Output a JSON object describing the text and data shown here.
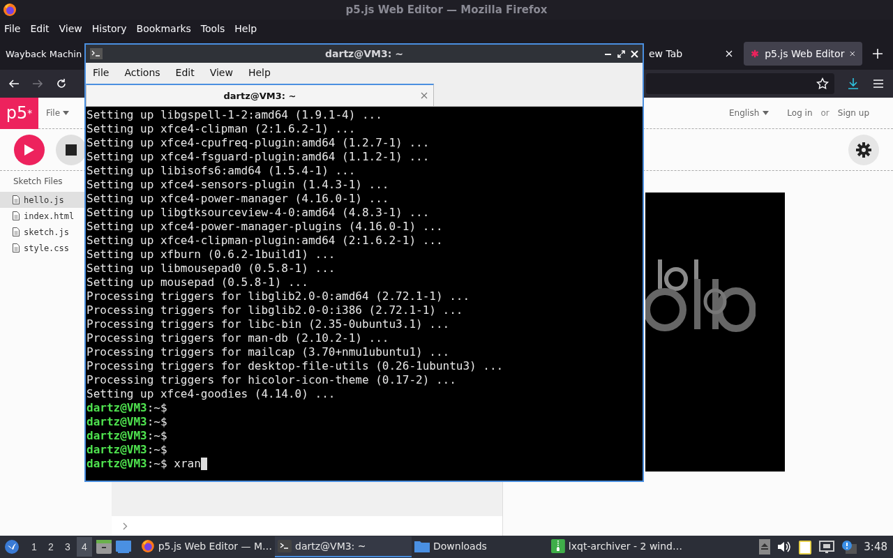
{
  "firefox": {
    "title": "p5.js Web Editor — Mozilla Firefox",
    "menu": [
      "File",
      "Edit",
      "View",
      "History",
      "Bookmarks",
      "Tools",
      "Help"
    ],
    "tabs": [
      {
        "label": "Wayback Machin",
        "selected": false,
        "kind": "cut"
      },
      {
        "label": "ew Tab",
        "selected": false,
        "kind": "plain"
      },
      {
        "label": "p5.js Web Editor",
        "selected": true,
        "kind": "p5"
      }
    ],
    "forward_disabled": true
  },
  "editor": {
    "logo": "p5$^{*}$",
    "file_menu": "File",
    "language": "English",
    "login": "Log in",
    "or": "or",
    "signup": "Sign up",
    "files_title": "Sketch Files",
    "files": [
      {
        "name": "hello.js",
        "selected": true
      },
      {
        "name": "index.html",
        "selected": false
      },
      {
        "name": "sketch.js",
        "selected": false
      },
      {
        "name": "style.css",
        "selected": false
      }
    ]
  },
  "terminal": {
    "title": "dartz@VM3: ~",
    "menu": [
      "File",
      "Actions",
      "Edit",
      "View",
      "Help"
    ],
    "tab": "dartz@VM3: ~",
    "lines": [
      {
        "kind": "output",
        "text": "Setting up libgspell-1-2:amd64 (1.9.1-4) ..."
      },
      {
        "kind": "output",
        "text": "Setting up xfce4-clipman (2:1.6.2-1) ..."
      },
      {
        "kind": "output",
        "text": "Setting up xfce4-cpufreq-plugin:amd64 (1.2.7-1) ..."
      },
      {
        "kind": "output",
        "text": "Setting up xfce4-fsguard-plugin:amd64 (1.1.2-1) ..."
      },
      {
        "kind": "output",
        "text": "Setting up libisofs6:amd64 (1.5.4-1) ..."
      },
      {
        "kind": "output",
        "text": "Setting up xfce4-sensors-plugin (1.4.3-1) ..."
      },
      {
        "kind": "output",
        "text": "Setting up xfce4-power-manager (4.16.0-1) ..."
      },
      {
        "kind": "output",
        "text": "Setting up libgtksourceview-4-0:amd64 (4.8.3-1) ..."
      },
      {
        "kind": "output",
        "text": "Setting up xfce4-power-manager-plugins (4.16.0-1) ..."
      },
      {
        "kind": "output",
        "text": "Setting up xfce4-clipman-plugin:amd64 (2:1.6.2-1) ..."
      },
      {
        "kind": "output",
        "text": "Setting up xfburn (0.6.2-1build1) ..."
      },
      {
        "kind": "output",
        "text": "Setting up libmousepad0 (0.5.8-1) ..."
      },
      {
        "kind": "output",
        "text": "Setting up mousepad (0.5.8-1) ..."
      },
      {
        "kind": "output",
        "text": "Processing triggers for libglib2.0-0:amd64 (2.72.1-1) ..."
      },
      {
        "kind": "output",
        "text": "Processing triggers for libglib2.0-0:i386 (2.72.1-1) ..."
      },
      {
        "kind": "output",
        "text": "Processing triggers for libc-bin (2.35-0ubuntu3.1) ..."
      },
      {
        "kind": "output",
        "text": "Processing triggers for man-db (2.10.2-1) ..."
      },
      {
        "kind": "output",
        "text": "Processing triggers for mailcap (3.70+nmu1ubuntu1) ..."
      },
      {
        "kind": "output",
        "text": "Processing triggers for desktop-file-utils (0.26-1ubuntu3) ..."
      },
      {
        "kind": "output",
        "text": "Processing triggers for hicolor-icon-theme (0.17-2) ..."
      },
      {
        "kind": "output",
        "text": "Setting up xfce4-goodies (4.14.0) ..."
      },
      {
        "kind": "prompt",
        "user": "dartz@VM3",
        "rest": ":~$",
        "cursor": false
      },
      {
        "kind": "prompt",
        "user": "dartz@VM3",
        "rest": ":~$",
        "cursor": false
      },
      {
        "kind": "prompt",
        "user": "dartz@VM3",
        "rest": ":~$",
        "cursor": false
      },
      {
        "kind": "prompt",
        "user": "dartz@VM3",
        "rest": ":~$",
        "cursor": false
      },
      {
        "kind": "prompt",
        "user": "dartz@VM3",
        "rest": ":~$",
        "command": "xran",
        "cursor": true
      }
    ]
  },
  "taskbar": {
    "desktops": [
      {
        "label": "1",
        "selected": false
      },
      {
        "label": "2",
        "selected": false
      },
      {
        "label": "3",
        "selected": false
      },
      {
        "label": "4",
        "selected": true
      }
    ],
    "tasks": [
      {
        "label": "p5.js Web Editor — M…",
        "kind": "firefox",
        "selected": false
      },
      {
        "label": "dartz@VM3: ~",
        "kind": "terminal",
        "selected": true
      },
      {
        "label": "Downloads",
        "kind": "folder",
        "selected": false
      },
      {
        "label": "lxqt-archiver - 2 wind…",
        "kind": "archive",
        "selected": false
      }
    ],
    "clock": "3:48"
  }
}
